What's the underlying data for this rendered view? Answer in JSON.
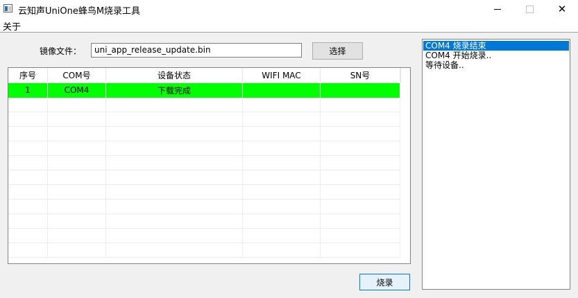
{
  "window": {
    "title": "云知声UniOne蜂鸟M烧录工具",
    "min_glyph": "",
    "close_glyph": "✕"
  },
  "menu": {
    "items": [
      "关于"
    ]
  },
  "file_row": {
    "label": "镜像文件：",
    "value": "uni_app_release_update.bin",
    "select_label": "选择"
  },
  "table": {
    "columns": [
      "序号",
      "COM号",
      "设备状态",
      "WIFI MAC",
      "SN号"
    ],
    "rows": [
      [
        "1",
        "COM4",
        "下载完成",
        "",
        ""
      ]
    ],
    "empty_rows": 11,
    "active_row_color": "#00ff00"
  },
  "burn_label": "烧录",
  "log": {
    "lines": [
      "COM4 烧录结束",
      "COM4 开始烧录..",
      "等待设备.."
    ],
    "selected_index": 0,
    "selected_color": "#0078d7"
  }
}
